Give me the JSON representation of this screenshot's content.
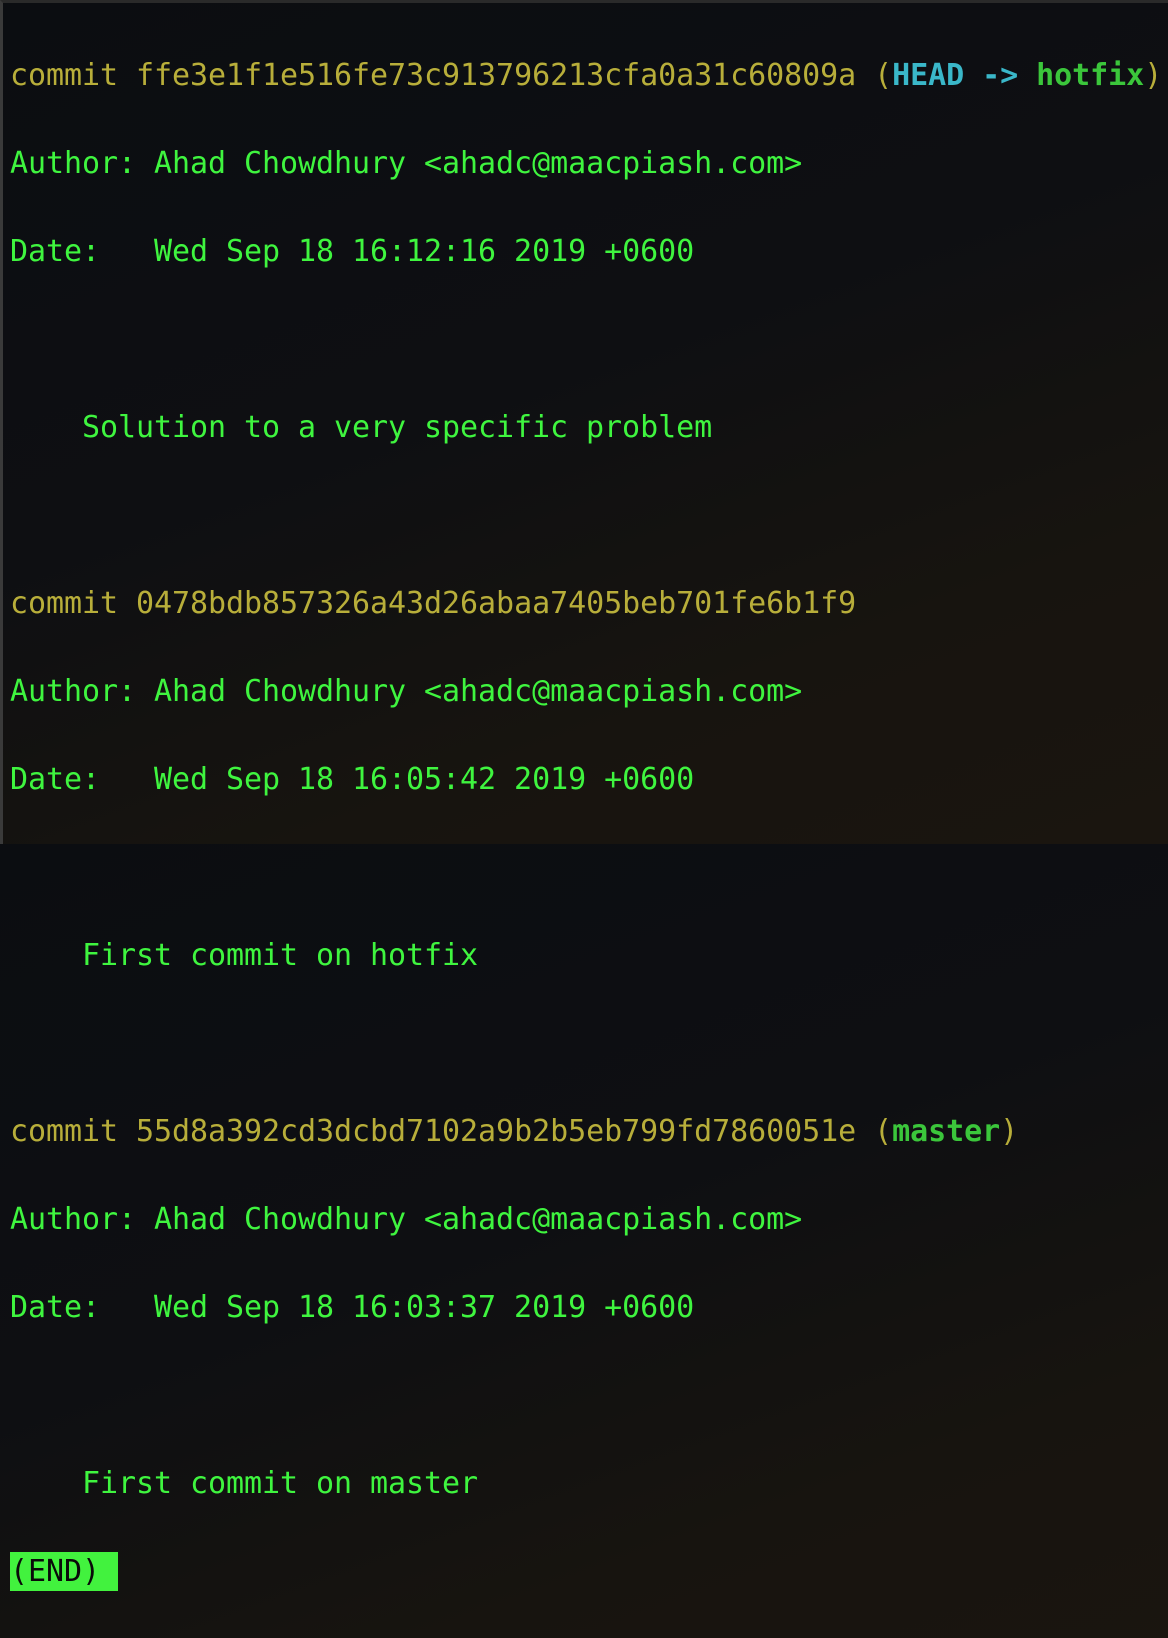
{
  "commits": [
    {
      "label": "commit",
      "hash": "ffe3e1f1e516fe73c913796213cfa0a31c60809a",
      "refs": {
        "head": "HEAD",
        "arrow": "->",
        "branch": "hotfix"
      },
      "author_label": "Author:",
      "author": "Ahad Chowdhury <ahadc@maacpiash.com>",
      "date_label": "Date:",
      "date": "Wed Sep 18 16:12:16 2019 +0600",
      "message": "Solution to a very specific problem"
    },
    {
      "label": "commit",
      "hash": "0478bdb857326a43d26abaa7405beb701fe6b1f9",
      "author_label": "Author:",
      "author": "Ahad Chowdhury <ahadc@maacpiash.com>",
      "date_label": "Date:",
      "date": "Wed Sep 18 16:05:42 2019 +0600",
      "message": "First commit on hotfix"
    },
    {
      "label": "commit",
      "hash": "55d8a392cd3dcbd7102a9b2b5eb799fd7860051e",
      "refs": {
        "branch": "master"
      },
      "author_label": "Author:",
      "author": "Ahad Chowdhury <ahadc@maacpiash.com>",
      "date_label": "Date:",
      "date": "Wed Sep 18 16:03:37 2019 +0600",
      "message": "First commit on master"
    }
  ],
  "pager_status": "(END)",
  "colors": {
    "hash": "#b8ae3a",
    "text": "#3ff53f",
    "head": "#3ab7c9",
    "branch": "#3bc63b"
  }
}
